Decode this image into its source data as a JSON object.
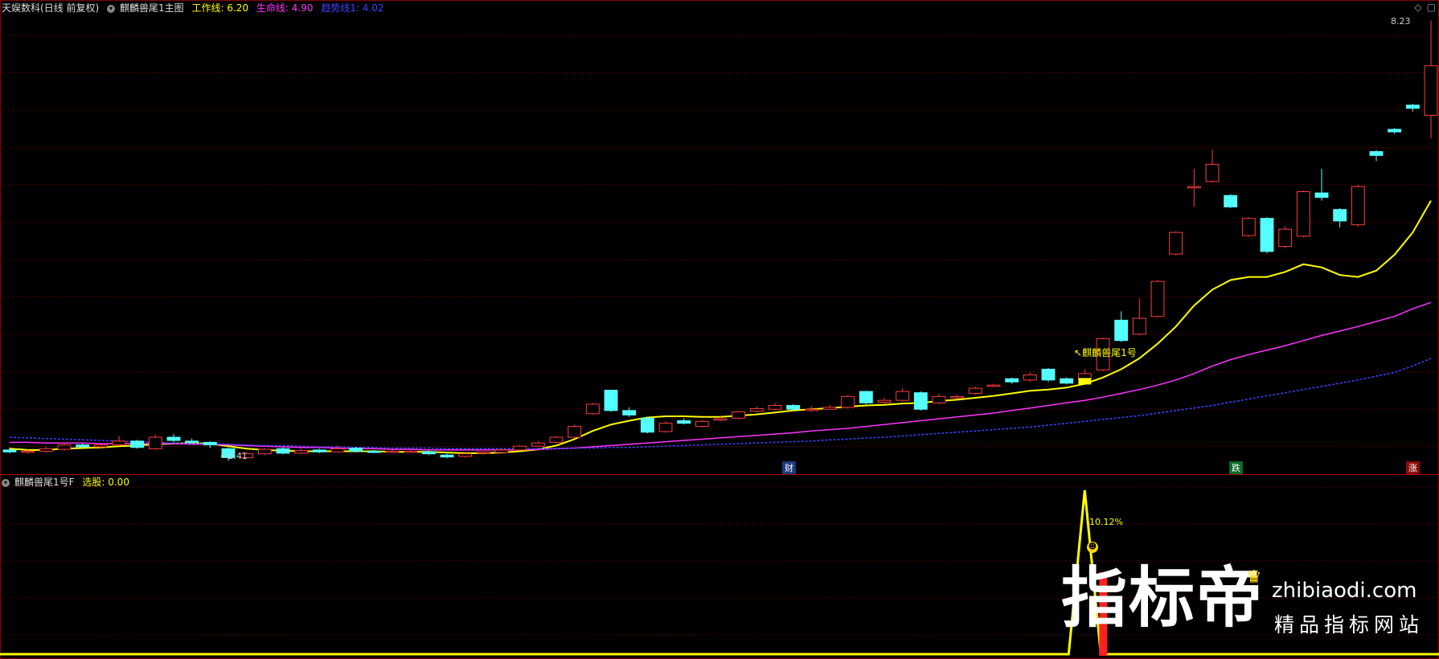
{
  "main_header": {
    "stock_name": "天娱数科",
    "period": "(日线 前复权)",
    "indicator": "麒麟兽尾1主图",
    "work_line": "工作线: 6.20",
    "life_line": "生命线: 4.90",
    "trend_line": "趋势线1: 4.02",
    "colors": {
      "work": "#ffff00",
      "life": "#ff33ff",
      "trend": "#3b44ff"
    }
  },
  "sub_header": {
    "indicator": "麒麟兽尾1号F",
    "select_stock": "选股: 0.00"
  },
  "annotations": {
    "high_price": "8.23",
    "low_price": "2.41",
    "signal_label": "麒麟兽尾1号",
    "signal_percent": "10.12%",
    "markers": [
      {
        "text": "财",
        "bg": "#1a3a7a",
        "color": "#ffffff"
      },
      {
        "text": "跌",
        "bg": "#0a6a2a",
        "color": "#ffffff"
      },
      {
        "text": "涨",
        "bg": "#8a0a0a",
        "color": "#ffffff"
      }
    ]
  },
  "corner_icons": [
    "diamond-icon",
    "window-icon"
  ],
  "watermark": {
    "big": "指标帝",
    "url": "zhibiaodi.com",
    "slogan": "精品指标网站"
  },
  "chart_data": {
    "type": "candlestick",
    "up_color": "#ff3b3b",
    "down_color": "#54ffff",
    "candles": [
      [
        2.58,
        2.55,
        2.62,
        2.53
      ],
      [
        2.55,
        2.56,
        2.59,
        2.52
      ],
      [
        2.56,
        2.6,
        2.63,
        2.54
      ],
      [
        2.59,
        2.66,
        2.7,
        2.57
      ],
      [
        2.66,
        2.63,
        2.68,
        2.61
      ],
      [
        2.63,
        2.66,
        2.69,
        2.6
      ],
      [
        2.66,
        2.72,
        2.8,
        2.64
      ],
      [
        2.72,
        2.62,
        2.74,
        2.6
      ],
      [
        2.6,
        2.78,
        2.82,
        2.58
      ],
      [
        2.78,
        2.73,
        2.83,
        2.7
      ],
      [
        2.72,
        2.7,
        2.76,
        2.68
      ],
      [
        2.7,
        2.66,
        2.72,
        2.61
      ],
      [
        2.6,
        2.46,
        2.62,
        2.41
      ],
      [
        2.46,
        2.52,
        2.55,
        2.44
      ],
      [
        2.52,
        2.59,
        2.61,
        2.5
      ],
      [
        2.6,
        2.53,
        2.62,
        2.51
      ],
      [
        2.53,
        2.57,
        2.6,
        2.51
      ],
      [
        2.58,
        2.55,
        2.6,
        2.53
      ],
      [
        2.55,
        2.6,
        2.65,
        2.54
      ],
      [
        2.61,
        2.56,
        2.63,
        2.54
      ],
      [
        2.56,
        2.55,
        2.58,
        2.53
      ],
      [
        2.55,
        2.56,
        2.58,
        2.54
      ],
      [
        2.56,
        2.56,
        2.58,
        2.54
      ],
      [
        2.55,
        2.52,
        2.57,
        2.5
      ],
      [
        2.5,
        2.47,
        2.52,
        2.45
      ],
      [
        2.48,
        2.52,
        2.53,
        2.46
      ],
      [
        2.53,
        2.55,
        2.56,
        2.51
      ],
      [
        2.54,
        2.58,
        2.6,
        2.53
      ],
      [
        2.58,
        2.64,
        2.66,
        2.57
      ],
      [
        2.64,
        2.69,
        2.72,
        2.63
      ],
      [
        2.7,
        2.78,
        2.8,
        2.69
      ],
      [
        2.78,
        2.95,
        2.98,
        2.77
      ],
      [
        3.15,
        3.3,
        3.32,
        3.13
      ],
      [
        3.52,
        3.2,
        3.53,
        3.18
      ],
      [
        3.2,
        3.13,
        3.25,
        3.1
      ],
      [
        3.08,
        2.86,
        3.1,
        2.84
      ],
      [
        2.87,
        3.0,
        3.03,
        2.85
      ],
      [
        3.04,
        3.0,
        3.08,
        2.98
      ],
      [
        2.95,
        3.03,
        3.05,
        2.93
      ],
      [
        3.05,
        3.07,
        3.12,
        3.03
      ],
      [
        3.08,
        3.18,
        3.2,
        3.06
      ],
      [
        3.19,
        3.23,
        3.26,
        3.17
      ],
      [
        3.22,
        3.28,
        3.32,
        3.2
      ],
      [
        3.28,
        3.22,
        3.3,
        3.2
      ],
      [
        3.2,
        3.22,
        3.27,
        3.18
      ],
      [
        3.22,
        3.25,
        3.29,
        3.21
      ],
      [
        3.25,
        3.42,
        3.44,
        3.23
      ],
      [
        3.5,
        3.32,
        3.51,
        3.3
      ],
      [
        3.33,
        3.36,
        3.4,
        3.3
      ],
      [
        3.36,
        3.5,
        3.55,
        3.34
      ],
      [
        3.48,
        3.22,
        3.5,
        3.2
      ],
      [
        3.32,
        3.42,
        3.46,
        3.3
      ],
      [
        3.4,
        3.42,
        3.45,
        3.38
      ],
      [
        3.47,
        3.55,
        3.58,
        3.45
      ],
      [
        3.58,
        3.6,
        3.62,
        3.57
      ],
      [
        3.7,
        3.65,
        3.72,
        3.62
      ],
      [
        3.68,
        3.76,
        3.8,
        3.65
      ],
      [
        3.85,
        3.68,
        3.87,
        3.65
      ],
      [
        3.7,
        3.63,
        3.72,
        3.61
      ],
      [
        3.7,
        3.78,
        3.85,
        3.68
      ],
      [
        3.84,
        4.33,
        4.35,
        3.82
      ],
      [
        4.62,
        4.3,
        4.76,
        4.28
      ],
      [
        4.4,
        4.65,
        4.96,
        4.38
      ],
      [
        4.68,
        5.23,
        5.25,
        4.66
      ],
      [
        5.66,
        6.0,
        6.02,
        5.64
      ],
      [
        6.7,
        6.72,
        7.0,
        6.4
      ],
      [
        6.8,
        7.07,
        7.3,
        6.78
      ],
      [
        6.58,
        6.4,
        6.6,
        6.38
      ],
      [
        5.95,
        6.22,
        6.24,
        5.93
      ],
      [
        6.22,
        5.7,
        6.24,
        5.67
      ],
      [
        5.78,
        6.05,
        6.1,
        5.75
      ],
      [
        5.94,
        6.64,
        6.66,
        5.92
      ],
      [
        6.62,
        6.55,
        7.0,
        6.5
      ],
      [
        6.36,
        6.18,
        6.38,
        6.08
      ],
      [
        6.12,
        6.72,
        6.75,
        6.09
      ],
      [
        7.27,
        7.21,
        7.29,
        7.12
      ],
      [
        7.62,
        7.58,
        7.64,
        7.55
      ],
      [
        8.0,
        7.95,
        8.02,
        7.9
      ],
      [
        7.84,
        8.62,
        9.33,
        7.48
      ]
    ],
    "series": [
      {
        "name": "工作线",
        "color": "#ffff00",
        "values": [
          2.6,
          2.58,
          2.58,
          2.6,
          2.61,
          2.62,
          2.64,
          2.65,
          2.67,
          2.68,
          2.69,
          2.68,
          2.64,
          2.6,
          2.58,
          2.57,
          2.56,
          2.56,
          2.56,
          2.56,
          2.56,
          2.55,
          2.55,
          2.55,
          2.54,
          2.53,
          2.53,
          2.54,
          2.56,
          2.59,
          2.65,
          2.75,
          2.88,
          2.98,
          3.04,
          3.09,
          3.11,
          3.11,
          3.1,
          3.1,
          3.12,
          3.14,
          3.17,
          3.2,
          3.22,
          3.24,
          3.26,
          3.28,
          3.29,
          3.31,
          3.32,
          3.35,
          3.37,
          3.4,
          3.43,
          3.47,
          3.51,
          3.53,
          3.56,
          3.62,
          3.72,
          3.85,
          4.02,
          4.25,
          4.52,
          4.85,
          5.1,
          5.25,
          5.3,
          5.3,
          5.38,
          5.5,
          5.45,
          5.33,
          5.3,
          5.4,
          5.65,
          6.0,
          6.5
        ]
      },
      {
        "name": "生命线",
        "color": "#ff33ff",
        "values": [
          2.7,
          2.7,
          2.69,
          2.69,
          2.69,
          2.68,
          2.68,
          2.68,
          2.68,
          2.68,
          2.67,
          2.67,
          2.66,
          2.65,
          2.64,
          2.63,
          2.62,
          2.62,
          2.61,
          2.6,
          2.6,
          2.59,
          2.59,
          2.58,
          2.58,
          2.58,
          2.58,
          2.58,
          2.58,
          2.59,
          2.6,
          2.61,
          2.63,
          2.65,
          2.67,
          2.69,
          2.71,
          2.73,
          2.75,
          2.77,
          2.79,
          2.81,
          2.83,
          2.85,
          2.88,
          2.9,
          2.92,
          2.95,
          2.98,
          3.01,
          3.04,
          3.07,
          3.1,
          3.13,
          3.16,
          3.2,
          3.24,
          3.28,
          3.32,
          3.36,
          3.41,
          3.47,
          3.53,
          3.6,
          3.68,
          3.78,
          3.9,
          4.0,
          4.08,
          4.15,
          4.22,
          4.3,
          4.38,
          4.45,
          4.52,
          4.6,
          4.68,
          4.8,
          4.9
        ]
      },
      {
        "name": "趋势线1",
        "color": "#3b44ff",
        "values": [
          2.78,
          2.77,
          2.76,
          2.75,
          2.74,
          2.73,
          2.72,
          2.71,
          2.7,
          2.69,
          2.68,
          2.68,
          2.67,
          2.66,
          2.65,
          2.65,
          2.64,
          2.63,
          2.63,
          2.62,
          2.62,
          2.61,
          2.61,
          2.61,
          2.6,
          2.6,
          2.6,
          2.6,
          2.6,
          2.6,
          2.6,
          2.61,
          2.61,
          2.62,
          2.62,
          2.63,
          2.64,
          2.65,
          2.66,
          2.67,
          2.68,
          2.69,
          2.7,
          2.71,
          2.72,
          2.74,
          2.75,
          2.77,
          2.78,
          2.8,
          2.82,
          2.84,
          2.86,
          2.88,
          2.9,
          2.92,
          2.94,
          2.97,
          3.0,
          3.03,
          3.06,
          3.09,
          3.12,
          3.16,
          3.2,
          3.24,
          3.28,
          3.33,
          3.38,
          3.43,
          3.48,
          3.53,
          3.58,
          3.63,
          3.68,
          3.74,
          3.8,
          3.9,
          4.02
        ]
      }
    ],
    "signal_spike": {
      "index": 59,
      "value": 10.12
    }
  }
}
